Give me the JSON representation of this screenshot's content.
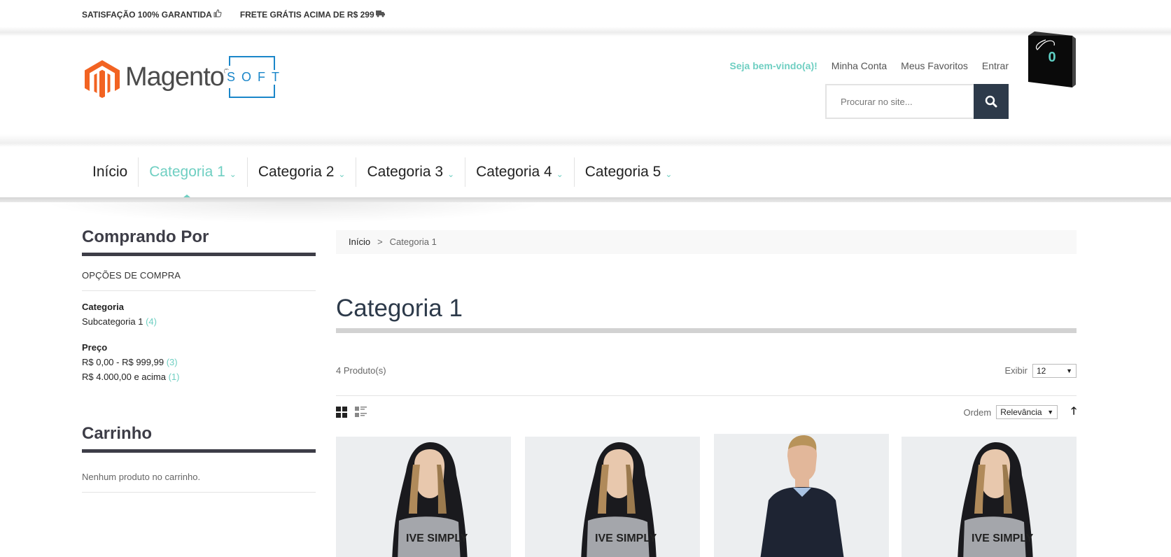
{
  "topbar": {
    "items": [
      {
        "text": "SATISFAÇÃO 100% GARANTIDA",
        "icon": "thumbs-up-icon"
      },
      {
        "text": "FRETE GRÁTIS ACIMA DE R$ 299",
        "icon": "truck-icon"
      }
    ]
  },
  "header": {
    "logo_text": "Magento",
    "logo_sub": "SOFT",
    "welcome": "Seja bem-vindo(a)!",
    "links": [
      "Minha Conta",
      "Meus Favoritos",
      "Entrar"
    ],
    "search_placeholder": "Procurar no site...",
    "cart_count": "0"
  },
  "nav": {
    "items": [
      {
        "label": "Início",
        "dropdown": false,
        "active": false
      },
      {
        "label": "Categoria 1",
        "dropdown": true,
        "active": true
      },
      {
        "label": "Categoria 2",
        "dropdown": true,
        "active": false
      },
      {
        "label": "Categoria 3",
        "dropdown": true,
        "active": false
      },
      {
        "label": "Categoria 4",
        "dropdown": true,
        "active": false
      },
      {
        "label": "Categoria 5",
        "dropdown": true,
        "active": false
      }
    ]
  },
  "sidebar": {
    "title": "Comprando Por",
    "subtitle": "OPÇÕES DE COMPRA",
    "filters": [
      {
        "name": "Categoria",
        "options": [
          {
            "label": "Subcategoria 1",
            "count": "(4)"
          }
        ]
      },
      {
        "name": "Preço",
        "options": [
          {
            "label": "R$ 0,00 - R$ 999,99",
            "count": "(3)"
          },
          {
            "label": "R$ 4.000,00 e acima",
            "count": "(1)"
          }
        ]
      }
    ],
    "cart_title": "Carrinho",
    "cart_empty": "Nenhum produto no carrinho."
  },
  "main": {
    "breadcrumb": {
      "home": "Início",
      "separator": ">",
      "current": "Categoria 1"
    },
    "title": "Categoria 1",
    "count": "4 Produto(s)",
    "show_label": "Exibir",
    "show_value": "12",
    "sort_label": "Ordem",
    "sort_value": "Relevância",
    "sort_dir_icon": "arrow-up-icon",
    "view_modes": [
      "grid-view-icon",
      "list-view-icon"
    ]
  },
  "products": [
    {
      "image": "woman-hoodie-image"
    },
    {
      "image": "woman-hoodie-image"
    },
    {
      "image": "man-sweater-image"
    },
    {
      "image": "woman-hoodie-image"
    }
  ],
  "colors": {
    "accent": "#6fcfc2",
    "dark": "#2d3a4a",
    "magento_orange": "#f26322",
    "soft_blue": "#1a86c9"
  }
}
